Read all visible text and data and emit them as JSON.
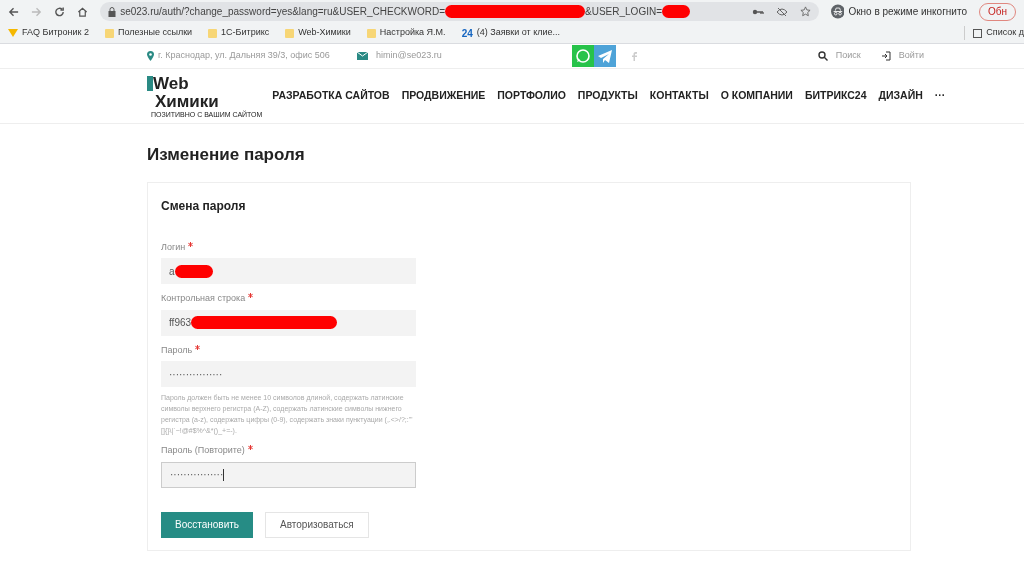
{
  "browser": {
    "url_parts": [
      "se023.ru/auth/?change_password=yes&lang=ru&USER_CHECKWORD=",
      "&USER_LOGIN="
    ],
    "incognito_label": "Окно в режиме инкогнито",
    "update_button": "Обн",
    "bookmarks": [
      {
        "label": "FAQ Битроник 2",
        "kind": "star"
      },
      {
        "label": "Полезные ссылки",
        "kind": "folder"
      },
      {
        "label": "1С-Битрикс",
        "kind": "folder"
      },
      {
        "label": "Web-Химики",
        "kind": "folder"
      },
      {
        "label": "Настройка Я.М.",
        "kind": "folder"
      },
      {
        "label": "(4) Заявки от клие...",
        "kind": "site",
        "badge": "24"
      }
    ],
    "reading_list": "Список д"
  },
  "topbar": {
    "address": "г. Краснодар, ул. Дальняя 39/3, офис 506",
    "email": "himin@se023.ru",
    "search": "Поиск",
    "login": "Войти"
  },
  "logo": {
    "line1": "Web",
    "line2": "Химики",
    "tagline": "ПОЗИТИВНО С ВАШИМ САЙТОМ"
  },
  "nav": [
    "РАЗРАБОТКА САЙТОВ",
    "ПРОДВИЖЕНИЕ",
    "ПОРТФОЛИО",
    "ПРОДУКТЫ",
    "КОНТАКТЫ",
    "О КОМПАНИИ",
    "БИТРИКС24",
    "ДИЗАЙН",
    "···"
  ],
  "page_title": "Изменение пароля",
  "form": {
    "title": "Смена пароля",
    "fields": [
      {
        "label": "Логин",
        "required": true,
        "value": "a",
        "redacted": true
      },
      {
        "label": "Контрольная строка",
        "required": true,
        "value": "ff963",
        "redacted": true
      },
      {
        "label": "Пароль",
        "required": true,
        "value": "················",
        "hint": "Пароль должен быть не менее 10 символов длиной, содержать латинские символы верхнего регистра (A-Z), содержать латинские символы нижнего регистра (a-z), содержать цифры (0-9), содержать знаки пунктуации (,.<>/?;:'\"[]{}\\|`~!@#$%^&*()_+=-)."
      },
      {
        "label": "Пароль (Повторите)",
        "required": true,
        "value": "················",
        "focused": true
      }
    ],
    "buttons": [
      {
        "label": "Восстановить",
        "kind": "primary"
      },
      {
        "label": "Авторизоваться",
        "kind": "secondary"
      }
    ]
  }
}
